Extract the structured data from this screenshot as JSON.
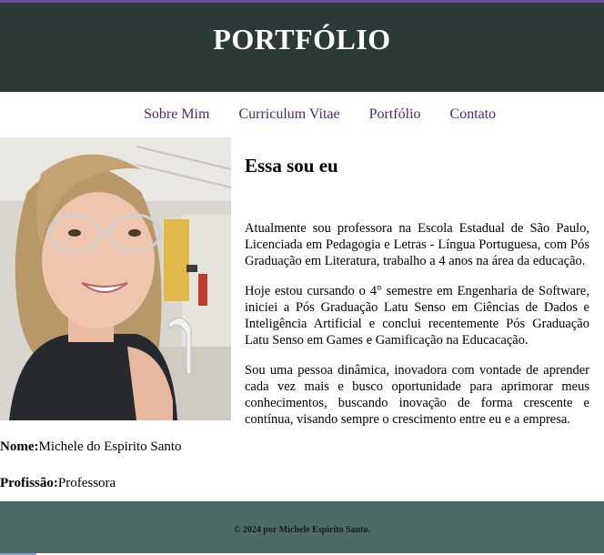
{
  "header": {
    "title": "PORTFÓLIO"
  },
  "nav": {
    "items": [
      {
        "label": "Sobre Mim"
      },
      {
        "label": "Curriculum Vitae"
      },
      {
        "label": "Portfólio"
      },
      {
        "label": "Contato"
      }
    ]
  },
  "profile": {
    "name_label": "Nome:",
    "name_value": "Michele do Espirito Santo",
    "profession_label": "Profissão:",
    "profession_value": "Professora"
  },
  "about": {
    "heading": "Essa sou eu",
    "paragraphs": [
      "Atualmente sou professora na Escola Estadual de São Paulo, Licenciada em Pedagogia e Letras - Língua Portuguesa, com Pós Graduação em Literatura, trabalho a 4 anos na área da educação.",
      "Hoje estou cursando o 4° semestre em Engenharia de Software, iniciei a Pós Graduação Latu Senso em Ciências de Dados e Inteligência Artificial e conclui recentemente Pós Graduação Latu Senso em Games e Gamificação na Educacação.",
      "Sou uma pessoa dinâmica, inovadora com vontade de aprender cada vez mais e busco oportunidade para aprimorar meus conhecimentos, buscando inovação de forma crescente e contínua, visando sempre o crescimento entre eu e a empresa."
    ]
  },
  "footer": {
    "text": "© 2024 por Michele Espirito Santo."
  },
  "colors": {
    "header_bg": "#2c3a37",
    "footer_bg": "#4d6b66",
    "nav_link": "#4a2a73"
  }
}
